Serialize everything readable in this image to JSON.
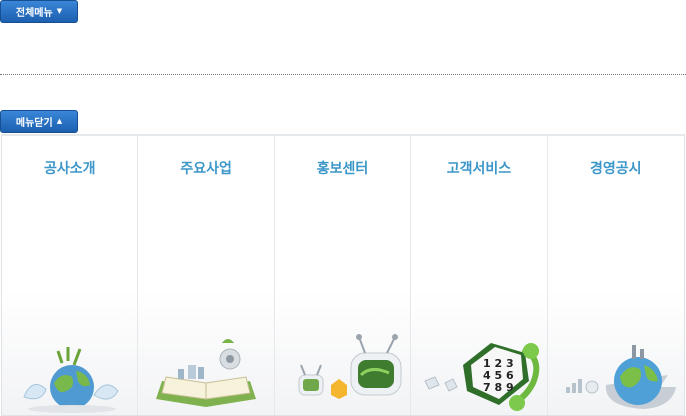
{
  "top_button": {
    "label": "전체메뉴",
    "icon": "caret-down-icon"
  },
  "close_button": {
    "label": "메뉴닫기",
    "icon": "caret-up-icon"
  },
  "menu": {
    "items": [
      {
        "label": "공사소개",
        "icon": "globe-eggshell-icon"
      },
      {
        "label": "주요사업",
        "icon": "open-book-icon"
      },
      {
        "label": "홍보센터",
        "icon": "tv-robot-icon"
      },
      {
        "label": "고객서비스",
        "icon": "phone-keypad-icon"
      },
      {
        "label": "경영공시",
        "icon": "globe-arrow-icon"
      }
    ]
  },
  "colors": {
    "button": "#2a72c8",
    "title": "#3b96c9"
  }
}
